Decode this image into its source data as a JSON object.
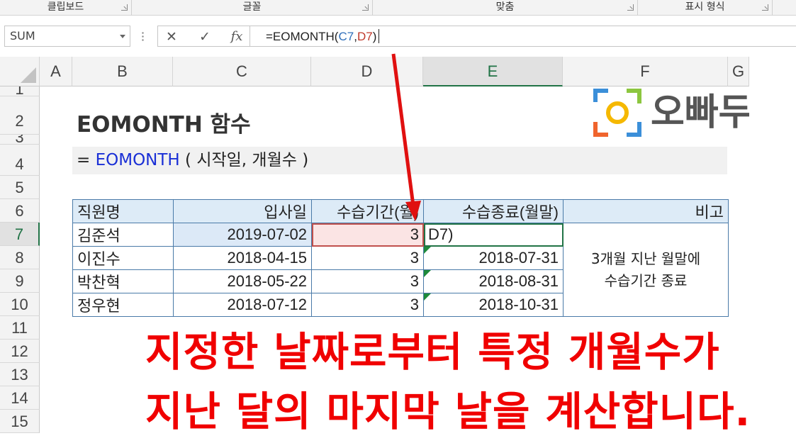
{
  "ribbon": {
    "groups": [
      "클립보드",
      "글꼴",
      "맞춤",
      "표시 형식"
    ]
  },
  "formula_bar": {
    "name_box": "SUM",
    "cancel_icon": "✕",
    "enter_icon": "✓",
    "fx_label": "fx",
    "formula_prefix": "=EOMONTH(",
    "ref1": "C7",
    "comma": ",",
    "ref2": "D7",
    "formula_suffix": ")"
  },
  "columns": [
    "A",
    "B",
    "C",
    "D",
    "E",
    "F",
    "G"
  ],
  "rows": [
    "1",
    "2",
    "3",
    "4",
    "5",
    "6",
    "7",
    "8",
    "9",
    "10",
    "11",
    "12",
    "13",
    "14",
    "15"
  ],
  "sheet": {
    "title": "EOMONTH 함수",
    "syntax_prefix": "= ",
    "syntax_fn": "EOMONTH",
    "syntax_args": " ( 시작일, 개월수 )",
    "logo_text": "오빠두"
  },
  "table": {
    "headers": [
      "직원명",
      "입사일",
      "수습기간(월)",
      "수습종료(월말)",
      "비고"
    ],
    "rows": [
      {
        "name": "김준석",
        "start": "2019-07-02",
        "months": "3",
        "end": "D7)"
      },
      {
        "name": "이진수",
        "start": "2018-04-15",
        "months": "3",
        "end": "2018-07-31"
      },
      {
        "name": "박찬혁",
        "start": "2018-05-22",
        "months": "3",
        "end": "2018-08-31"
      },
      {
        "name": "정우현",
        "start": "2018-07-12",
        "months": "3",
        "end": "2018-10-31"
      }
    ],
    "note_line1": "3개월 지난 월말에",
    "note_line2": "수습기간 종료"
  },
  "caption": {
    "line1": "지정한 날짜로부터 특정 개월수가",
    "line2": "지난 달의 마지막 날을 계산합니다."
  },
  "colors": {
    "excel_green": "#217346",
    "annotation_red": "#e01010",
    "function_blue": "#1a2fd6",
    "table_border": "#4a7aa8",
    "header_fill": "#ddebf7"
  },
  "icons": {
    "name_box_dropdown": "chevron-down-icon",
    "cancel": "close-icon",
    "enter": "check-icon",
    "insert_function": "fx-icon",
    "select_all": "select-all-triangle-icon",
    "logo": "oppadu-logo-icon"
  }
}
